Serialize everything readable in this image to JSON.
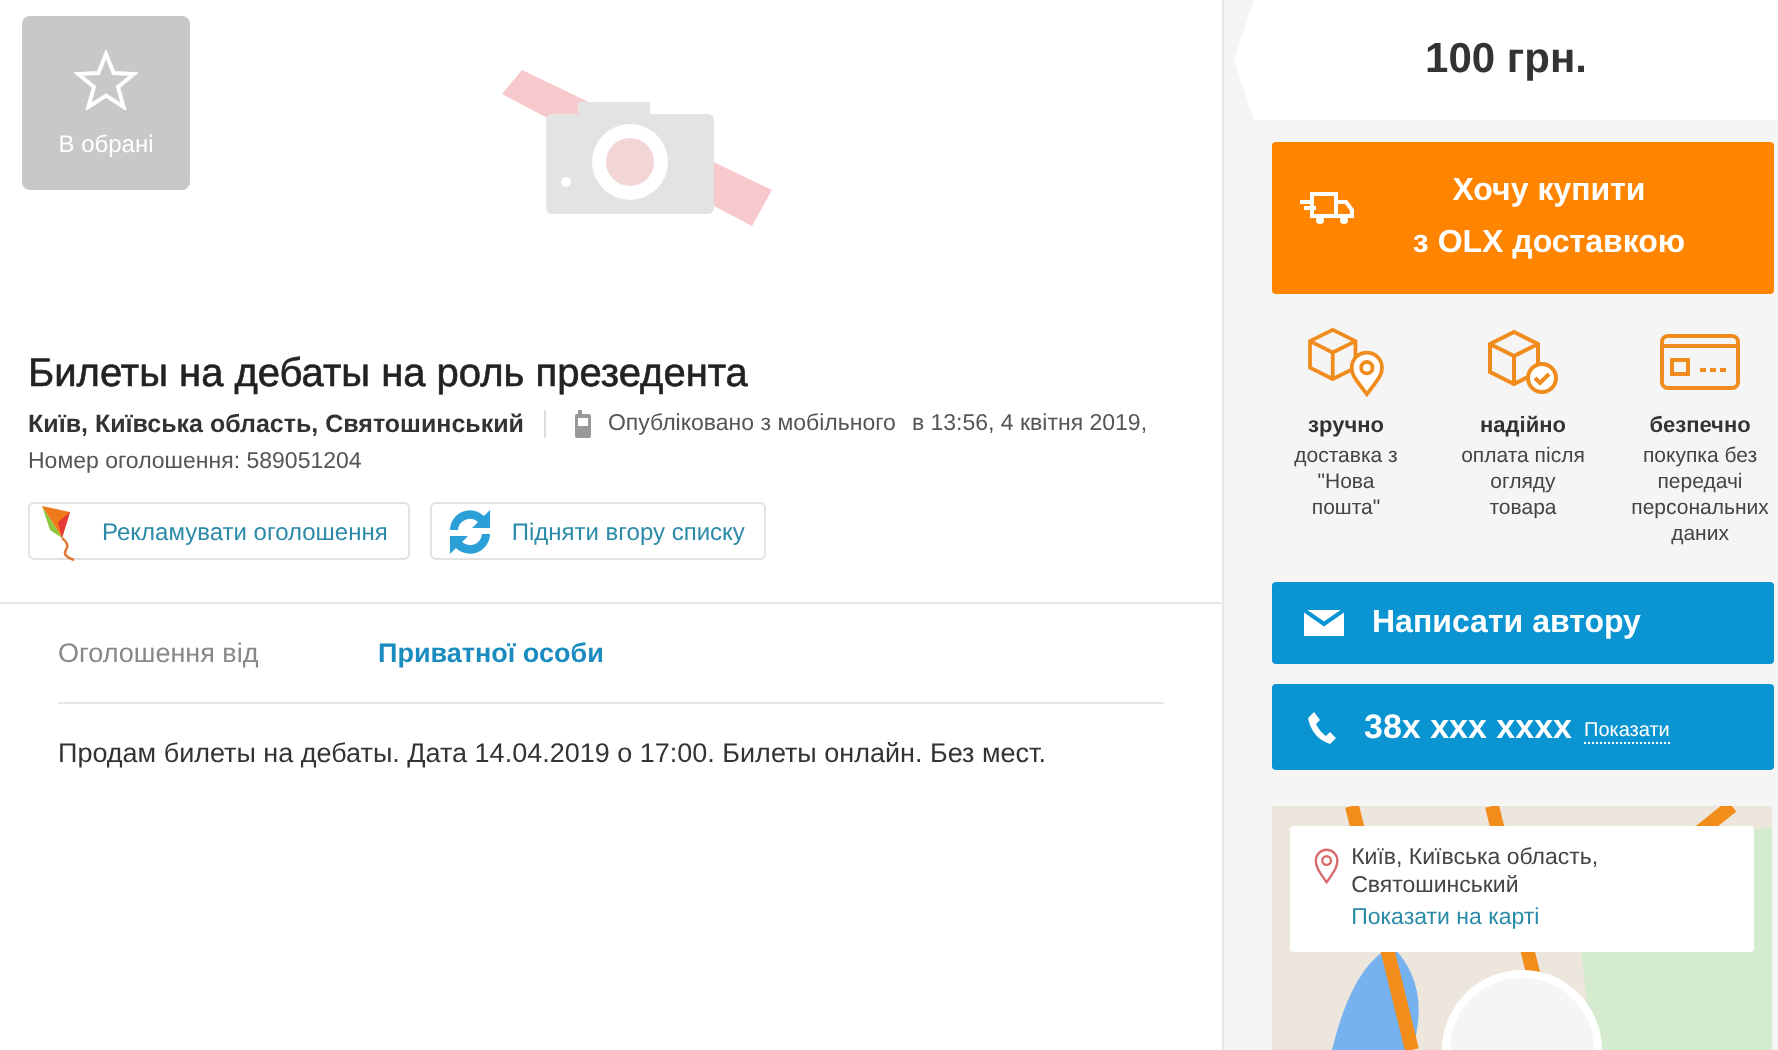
{
  "favorite": {
    "label": "В обрані"
  },
  "listing": {
    "title": "Билеты на дебаты на роль презедента",
    "location": "Київ, Київська область, Святошинський",
    "published": "Опубліковано з мобільного",
    "time": "в 13:56, 4 квітня 2019,",
    "ad_number": "Номер оголошення: 589051204"
  },
  "actions": [
    {
      "label": "Рекламувати оголошення",
      "kind": "promote"
    },
    {
      "label": "Підняти вгору списку",
      "kind": "refresh"
    }
  ],
  "details": [
    {
      "label": "Оголошення від",
      "value": "Приватної особи"
    }
  ],
  "description": "Продам билеты на дебаты. Дата 14.04.2019 о 17:00. Билеты онлайн. Без мест.",
  "price": "100 грн.",
  "delivery_button": {
    "lines": [
      "Хочу купити",
      "з OLX доставкою"
    ]
  },
  "benefits": [
    {
      "kind": "location",
      "title": "зручно",
      "text": "доставка з \"Нова пошта\""
    },
    {
      "kind": "check",
      "title": "надійно",
      "text": "оплата після огляду товара"
    },
    {
      "kind": "card",
      "title": "безпечно",
      "text": "покупка без передачі персональних даних"
    }
  ],
  "message_button": "Написати автору",
  "phone": {
    "number": "38x xxx xxxx",
    "link": "Показати"
  },
  "map": {
    "address": "Київ, Київська область, Святошинський",
    "link": "Показати на карті"
  }
}
